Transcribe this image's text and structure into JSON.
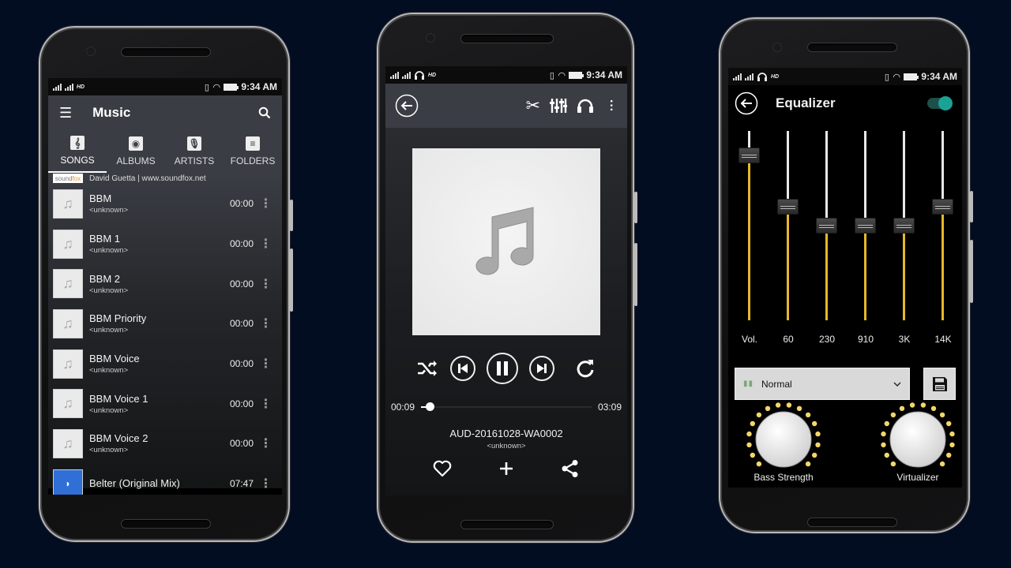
{
  "status_bar": {
    "time": "9:34 AM",
    "hd_label": "HD"
  },
  "music_list_screen": {
    "title": "Music",
    "tabs": [
      {
        "label": "SONGS",
        "icon": "treble-clef-icon",
        "active": true
      },
      {
        "label": "ALBUMS",
        "icon": "disc-icon",
        "active": false
      },
      {
        "label": "ARTISTS",
        "icon": "microphone-icon",
        "active": false
      },
      {
        "label": "FOLDERS",
        "icon": "list-icon",
        "active": false
      }
    ],
    "ad_row": {
      "logo_text_a": "sound",
      "logo_text_b": "fox",
      "text": "David Guetta | www.soundfox.net"
    },
    "songs": [
      {
        "title": "BBM",
        "artist": "<unknown>",
        "duration": "00:00"
      },
      {
        "title": "BBM 1",
        "artist": "<unknown>",
        "duration": "00:00"
      },
      {
        "title": "BBM 2",
        "artist": "<unknown>",
        "duration": "00:00"
      },
      {
        "title": "BBM Priority",
        "artist": "<unknown>",
        "duration": "00:00"
      },
      {
        "title": "BBM Voice",
        "artist": "<unknown>",
        "duration": "00:00"
      },
      {
        "title": "BBM Voice 1",
        "artist": "<unknown>",
        "duration": "00:00"
      },
      {
        "title": "BBM Voice 2",
        "artist": "<unknown>",
        "duration": "00:00"
      },
      {
        "title": "Belter (Original Mix)",
        "artist": "",
        "duration": "07:47"
      }
    ]
  },
  "player_screen": {
    "current_time": "00:09",
    "total_time": "03:09",
    "progress_fraction": 0.05,
    "song_title": "AUD-20161028-WA0002",
    "song_artist": "<unknown>"
  },
  "equalizer_screen": {
    "title": "Equalizer",
    "enabled": true,
    "accent_color": "#1aa394",
    "bar_color": "#e8b729",
    "bands": [
      {
        "label": "Vol.",
        "level": 0.87
      },
      {
        "label": "60",
        "level": 0.6
      },
      {
        "label": "230",
        "level": 0.5
      },
      {
        "label": "910",
        "level": 0.5
      },
      {
        "label": "3K",
        "level": 0.5
      },
      {
        "label": "14K",
        "level": 0.6
      }
    ],
    "preset": "Normal",
    "knobs": [
      {
        "label": "Bass Strength"
      },
      {
        "label": "Virtualizer"
      }
    ]
  }
}
